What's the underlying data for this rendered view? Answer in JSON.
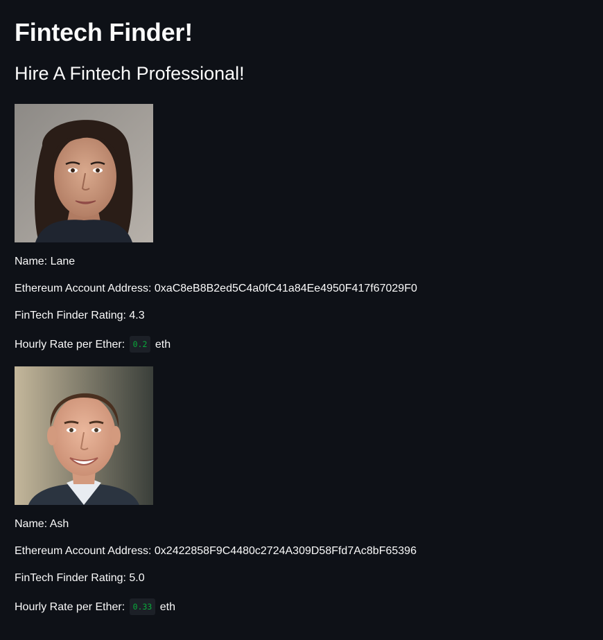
{
  "header": {
    "title": "Fintech Finder!",
    "subtitle": "Hire A Fintech Professional!"
  },
  "labels": {
    "name": "Name: ",
    "address": "Ethereum Account Address: ",
    "rating": "FinTech Finder Rating: ",
    "rate": "Hourly Rate per Ether: ",
    "unit": "eth"
  },
  "candidates": [
    {
      "name": "Lane",
      "address": "0xaC8eB8B2ed5C4a0fC41a84Ee4950F417f67029F0",
      "rating": "4.3",
      "hourly_rate": "0.2"
    },
    {
      "name": "Ash",
      "address": "0x2422858F9C4480c2724A309D58Ffd7Ac8bF65396",
      "rating": "5.0",
      "hourly_rate": "0.33"
    }
  ],
  "colors": {
    "background": "#0e1117",
    "text": "#fafafa",
    "code_text": "#09ab3b",
    "code_background": "#1c2027"
  }
}
